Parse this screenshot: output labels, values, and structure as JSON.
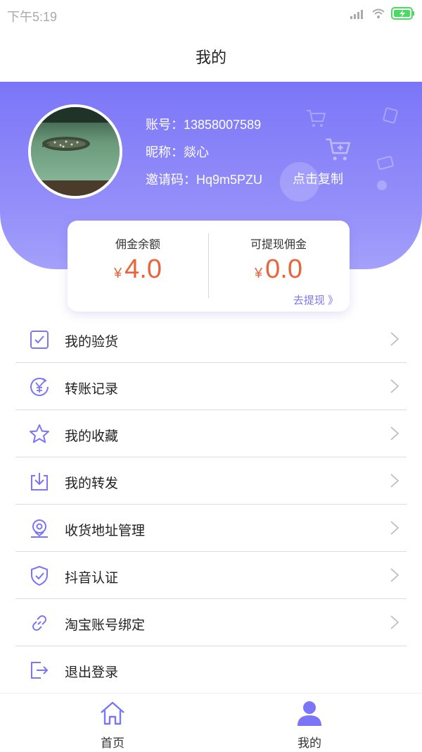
{
  "status_bar": {
    "time": "下午5:19"
  },
  "header": {
    "title": "我的"
  },
  "profile": {
    "account": "账号：13858007589",
    "nickname": "昵称：燚心",
    "invite_code": "邀请码：Hq9m5PZU",
    "copy_label": "点击复制"
  },
  "wallet": {
    "currency": "¥",
    "commission_balance_label": "佣金余额",
    "commission_balance": "4.0",
    "withdrawable_label": "可提现佣金",
    "withdrawable": "0.0",
    "withdraw_link": "去提现 》"
  },
  "menu": [
    {
      "label": "我的验货",
      "icon": "check-box-icon"
    },
    {
      "label": "转账记录",
      "icon": "yen-transfer-icon"
    },
    {
      "label": "我的收藏",
      "icon": "star-icon"
    },
    {
      "label": "我的转发",
      "icon": "download-share-icon"
    },
    {
      "label": "收货地址管理",
      "icon": "location-pin-icon"
    },
    {
      "label": "抖音认证",
      "icon": "shield-check-icon"
    },
    {
      "label": "淘宝账号绑定",
      "icon": "link-icon"
    },
    {
      "label": "退出登录",
      "icon": "logout-icon"
    }
  ],
  "tabbar": {
    "home": "首页",
    "mine": "我的"
  },
  "colors": {
    "accent": "#7b76f7",
    "amount": "#e8653c",
    "battery": "#4cd964"
  }
}
